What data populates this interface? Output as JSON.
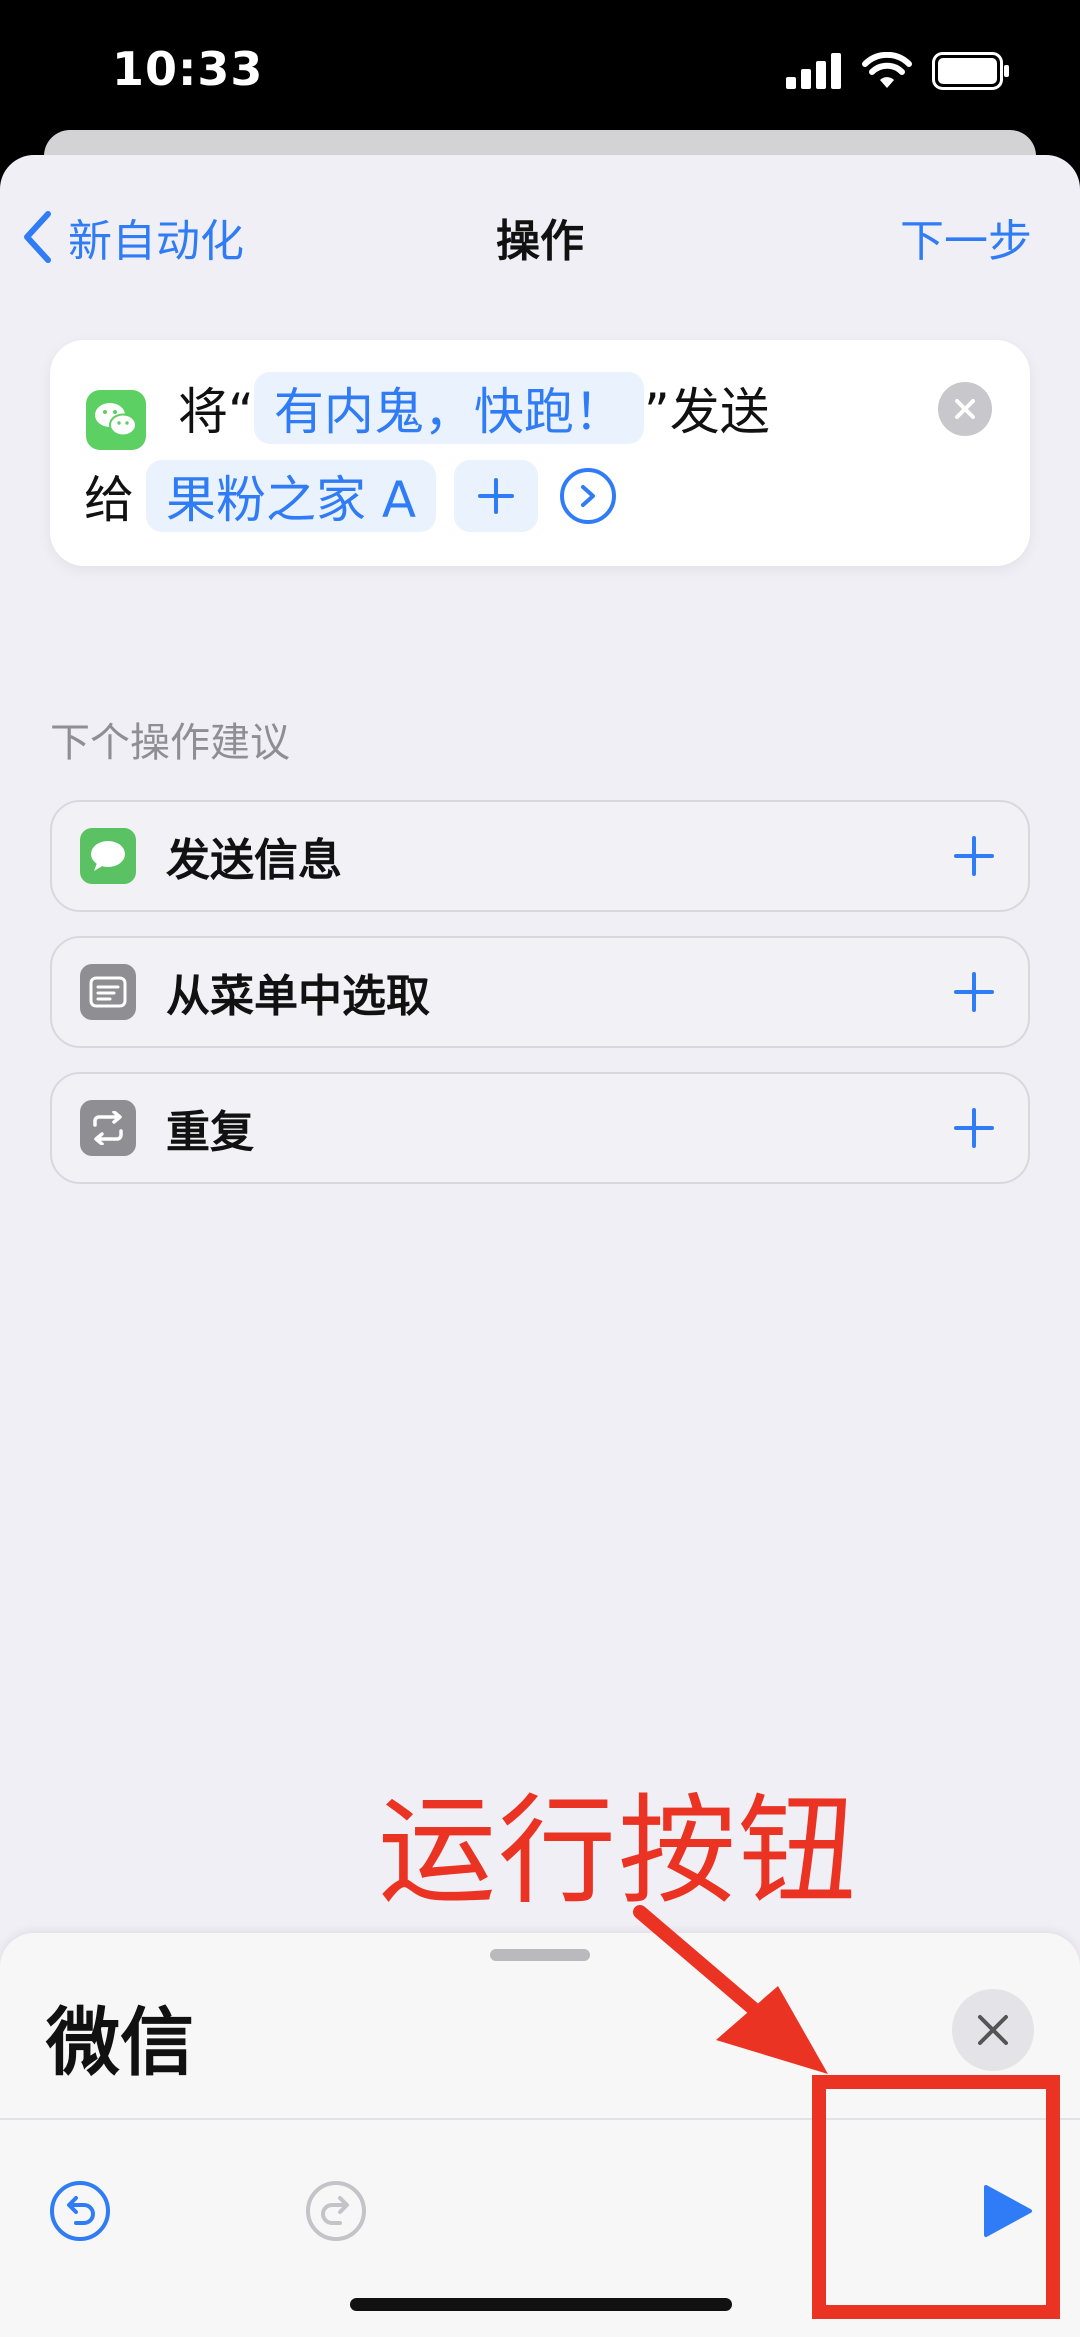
{
  "status_bar": {
    "time": "10:33",
    "icons": [
      "signal-icon",
      "wifi-icon",
      "battery-icon"
    ]
  },
  "nav": {
    "back_label": "新自动化",
    "title": "操作",
    "next_label": "下一步"
  },
  "action": {
    "app_icon": "wechat-icon",
    "prefix": "将“",
    "message": "有内鬼，快跑！",
    "suffix": "”发送",
    "to_label": "给",
    "recipient": "果粉之家 A",
    "add_symbol": "+"
  },
  "suggestions": {
    "title": "下个操作建议",
    "items": [
      {
        "label": "发送信息",
        "icon": "messages-icon",
        "color": "#5ac262"
      },
      {
        "label": "从菜单中选取",
        "icon": "menu-icon",
        "color": "#8e8e93"
      },
      {
        "label": "重复",
        "icon": "repeat-icon",
        "color": "#8e8e93"
      }
    ]
  },
  "annotation": {
    "text": "运行按钮",
    "color": "#ea3323"
  },
  "bottom_panel": {
    "title": "微信"
  },
  "colors": {
    "accent": "#2f7cf6",
    "background": "#f0eff5"
  }
}
